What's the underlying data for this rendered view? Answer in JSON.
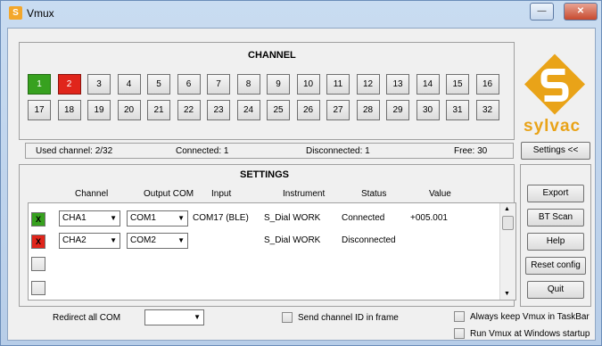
{
  "window": {
    "title": "Vmux",
    "app_icon": "S"
  },
  "channel_panel": {
    "title": "CHANNEL",
    "channels": [
      {
        "label": "1",
        "state": "active"
      },
      {
        "label": "2",
        "state": "disconnected"
      },
      {
        "label": "3"
      },
      {
        "label": "4"
      },
      {
        "label": "5"
      },
      {
        "label": "6"
      },
      {
        "label": "7"
      },
      {
        "label": "8"
      },
      {
        "label": "9"
      },
      {
        "label": "10"
      },
      {
        "label": "11"
      },
      {
        "label": "12"
      },
      {
        "label": "13"
      },
      {
        "label": "14"
      },
      {
        "label": "15"
      },
      {
        "label": "16"
      },
      {
        "label": "17"
      },
      {
        "label": "18"
      },
      {
        "label": "19"
      },
      {
        "label": "20"
      },
      {
        "label": "21"
      },
      {
        "label": "22"
      },
      {
        "label": "23"
      },
      {
        "label": "24"
      },
      {
        "label": "25"
      },
      {
        "label": "26"
      },
      {
        "label": "27"
      },
      {
        "label": "28"
      },
      {
        "label": "29"
      },
      {
        "label": "30"
      },
      {
        "label": "31"
      },
      {
        "label": "32"
      }
    ],
    "colors": {
      "active": "#37a11f",
      "disconnected": "#e0251b"
    }
  },
  "status": {
    "used": "Used channel: 2/32",
    "connected": "Connected: 1",
    "disconnected": "Disconnected: 1",
    "free": "Free: 30"
  },
  "brand": {
    "logo_text": "sylvac",
    "logo_color": "#e9a318"
  },
  "settings_toggle": "Settings <<",
  "settings_panel": {
    "title": "SETTINGS",
    "headers": {
      "channel": "Channel",
      "output": "Output COM",
      "input": "Input",
      "instrument": "Instrument",
      "status": "Status",
      "value": "Value"
    },
    "rows": [
      {
        "mark": "X",
        "channel": "CHA1",
        "output": "COM1",
        "input": "COM17 (BLE)",
        "instrument": "S_Dial WORK",
        "status": "Connected",
        "value": "+005.001"
      },
      {
        "mark": "X",
        "channel": "CHA2",
        "output": "COM2",
        "input": "",
        "instrument": "S_Dial WORK",
        "status": "Disconnected",
        "value": ""
      },
      {
        "mark": ""
      },
      {
        "mark": ""
      }
    ]
  },
  "side_buttons": {
    "export": "Export",
    "bt_scan": "BT Scan",
    "help": "Help",
    "reset": "Reset config",
    "quit": "Quit"
  },
  "footer": {
    "redirect_label": "Redirect all COM",
    "redirect_value": "",
    "send_channel_id": "Send channel ID in frame",
    "always_keep": "Always keep Vmux in TaskBar",
    "run_at_startup": "Run Vmux at Windows startup"
  }
}
